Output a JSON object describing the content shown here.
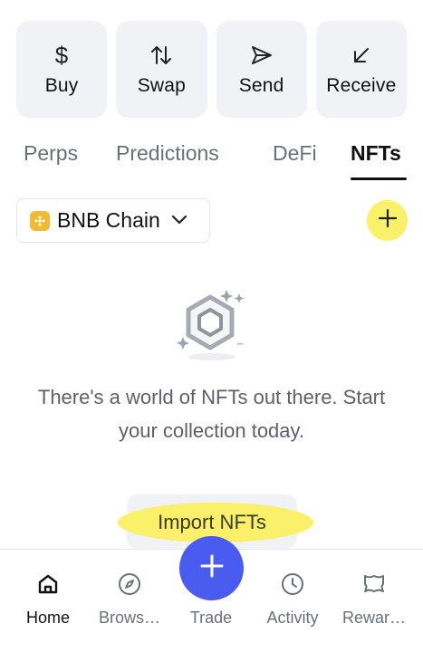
{
  "actions": [
    {
      "label": "Buy",
      "icon": "dollar-icon"
    },
    {
      "label": "Swap",
      "icon": "swap-icon"
    },
    {
      "label": "Send",
      "icon": "send-icon"
    },
    {
      "label": "Receive",
      "icon": "receive-icon"
    }
  ],
  "tabs": [
    {
      "label": "Perps",
      "active": false
    },
    {
      "label": "Predictions",
      "active": false
    },
    {
      "label": "DeFi",
      "active": false
    },
    {
      "label": "NFTs",
      "active": true
    }
  ],
  "chain_selector": {
    "label": "BNB Chain",
    "icon": "bnb-icon"
  },
  "add_button": {
    "icon": "plus-icon"
  },
  "empty_state": {
    "message": "There's a world of NFTs out there. Start your collection today.",
    "import_label": "Import NFTs"
  },
  "bottom_nav": [
    {
      "label": "Home",
      "icon": "home-icon",
      "active": true
    },
    {
      "label": "Brows…",
      "icon": "compass-icon",
      "active": false
    },
    {
      "label": "Trade",
      "icon": "plus-icon",
      "active": false
    },
    {
      "label": "Activity",
      "icon": "clock-icon",
      "active": false
    },
    {
      "label": "Rewar…",
      "icon": "rewards-icon",
      "active": false
    }
  ],
  "colors": {
    "highlight": "#fbf06a",
    "accent": "#4a5cf0",
    "button_bg": "#f1f2f5",
    "muted_text": "#6b6f76",
    "bnb": "#f3ba2f"
  }
}
